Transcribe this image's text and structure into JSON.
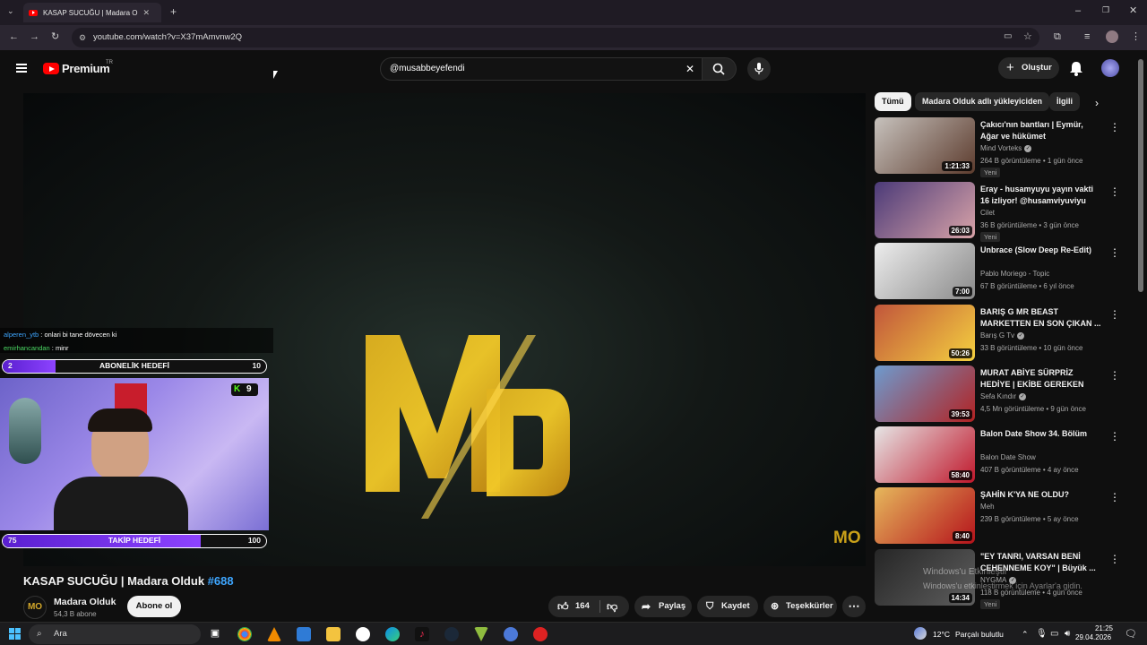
{
  "browser": {
    "tab_title": "KASAP SUCUĞU | Madara O",
    "url": "youtube.com/watch?v=X37mAmvnw2Q"
  },
  "youtube": {
    "brand": "Premium",
    "region": "TR",
    "search_value": "@musabbeyefendi",
    "create_label": "Oluştur"
  },
  "stream_overlay": {
    "chat": [
      {
        "user": "alperen_ytb",
        "message": " : onlari bi tane dövecen ki"
      },
      {
        "user": "emirhancandan",
        "message": " : minr"
      }
    ],
    "sub_goal": {
      "label": "ABONELİK HEDEFİ",
      "current": "2",
      "target": "10",
      "progress": 0.2
    },
    "follow_goal": {
      "label": "TAKİP HEDEFİ",
      "current": "75",
      "target": "100",
      "progress": 0.75
    },
    "kick_viewers": "9"
  },
  "video": {
    "title": "KASAP SUCUĞU | Madara Olduk",
    "episode": "#688",
    "channel": "Madara Olduk",
    "subscribers": "54,3 B abone",
    "subscribe_label": "Abone ol",
    "likes": "164",
    "share_label": "Paylaş",
    "save_label": "Kaydet",
    "thanks_label": "Teşekkürler",
    "watermark": "MO"
  },
  "chips": [
    "Tümü",
    "Madara Olduk adlı yükleyiciden",
    "İlgili"
  ],
  "recommendations": [
    {
      "title": "Çakıcı'nın bantları | Eymür, Ağar ve hükümet",
      "channel": "Mind Vorteks",
      "verified": true,
      "meta": "264 B görüntüleme • 1 gün önce",
      "duration": "1:21:33",
      "badge": "Yeni",
      "colors": [
        "#c7c2bd",
        "#5c3b2d"
      ]
    },
    {
      "title": "Eray - husamyuyu yayın vakti 16 izliyor! @husamviyuviyu",
      "channel": "Cilet",
      "verified": false,
      "meta": "36 B görüntüleme • 3 gün önce",
      "duration": "26:03",
      "badge": "Yeni",
      "colors": [
        "#4b3a78",
        "#d9a3a8"
      ]
    },
    {
      "title": "Unbrace (Slow Deep Re-Edit)",
      "channel": "Pablo Moriego - Topic",
      "verified": false,
      "meta": "67 B görüntüleme • 6 yıl önce",
      "duration": "7:00",
      "badge": "",
      "colors": [
        "#ededed",
        "#8a8a8a"
      ]
    },
    {
      "title": "BARIŞ G MR BEAST MARKETTEN EN SON ÇIKAN ...",
      "channel": "Barış G Tv",
      "verified": true,
      "meta": "33 B görüntüleme • 10 gün önce",
      "duration": "50:26",
      "badge": "",
      "colors": [
        "#c1553b",
        "#f4d03f"
      ]
    },
    {
      "title": "MURAT ABİYE SÜRPRİZ HEDİYE | EKİBE GEREKEN YAPILDI",
      "channel": "Sefa Kındır",
      "verified": true,
      "meta": "4,5 Mn görüntüleme • 9 gün önce",
      "duration": "39:53",
      "badge": "",
      "colors": [
        "#6d9bcf",
        "#b22222"
      ]
    },
    {
      "title": "Balon Date Show 34. Bölüm",
      "channel": "Balon Date Show",
      "verified": false,
      "meta": "407 B görüntüleme • 4 ay önce",
      "duration": "58:40",
      "badge": "",
      "colors": [
        "#e6e6e6",
        "#c0172b"
      ]
    },
    {
      "title": "ŞAHİN K'YA NE OLDU?",
      "channel": "Meh",
      "verified": false,
      "meta": "239 B görüntüleme • 5 ay önce",
      "duration": "8:40",
      "badge": "",
      "colors": [
        "#e6b85c",
        "#b5121b"
      ]
    },
    {
      "title": "\"EY TANRI, VARSAN BENİ CEHENNEME KOY\" | Büyük ...",
      "channel": "NYGMA",
      "verified": true,
      "meta": "118 B görüntüleme • 4 gün önce",
      "duration": "14:34",
      "badge": "Yeni",
      "colors": [
        "#262626",
        "#5e5e5e"
      ]
    }
  ],
  "windows_activation": {
    "line1": "Windows'u Etkinleştir",
    "line2": "Windows'u etkinleştirmek için Ayarlar'a gidin."
  },
  "taskbar": {
    "search_placeholder": "Ara",
    "weather": "12°C",
    "weather_text": "Parçalı bulutlu",
    "time": "21:25",
    "date": "29.04.2026"
  },
  "colors": {
    "accent": "#ff0000",
    "link": "#3ea6ff",
    "goal_fill": "#7b3cf0"
  }
}
